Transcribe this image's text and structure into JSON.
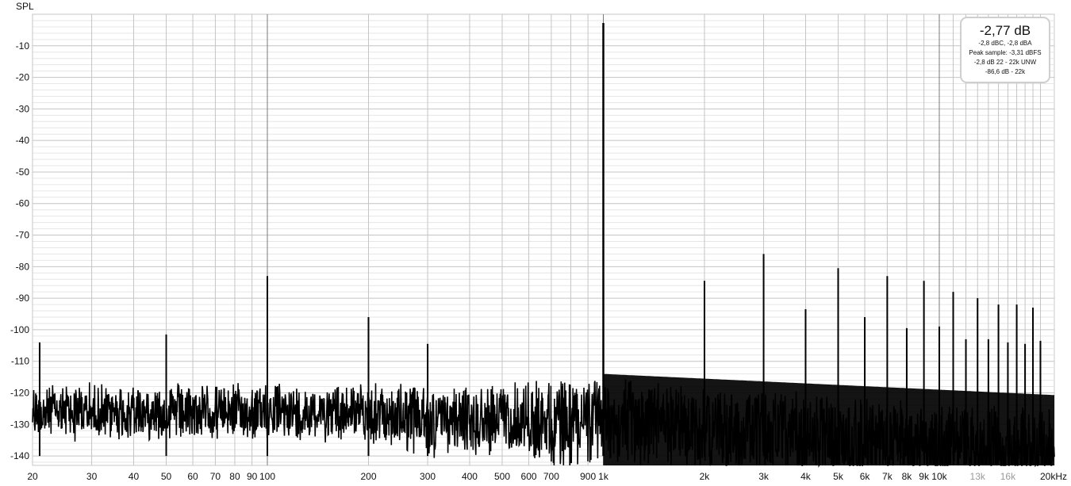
{
  "chart_data": {
    "type": "line",
    "ylabel": "SPL",
    "xscale": "log",
    "xlim": [
      20,
      22000
    ],
    "ylim": [
      -143,
      0
    ],
    "x_ticks": [
      "20",
      "30",
      "40",
      "50",
      "60",
      "70",
      "80",
      "90",
      "100",
      "200",
      "300",
      "400",
      "500",
      "600",
      "700",
      "900",
      "1k",
      "2k",
      "3k",
      "4k",
      "5k",
      "6k",
      "7k",
      "8k",
      "9k",
      "10k",
      "13k",
      "16k",
      "20kHz"
    ],
    "x_tick_values": [
      20,
      30,
      40,
      50,
      60,
      70,
      80,
      90,
      100,
      200,
      300,
      400,
      500,
      600,
      700,
      900,
      1000,
      2000,
      3000,
      4000,
      5000,
      6000,
      7000,
      8000,
      9000,
      10000,
      13000,
      16000,
      20000
    ],
    "y_ticks": [
      -10,
      -20,
      -30,
      -40,
      -50,
      -60,
      -70,
      -80,
      -90,
      -100,
      -110,
      -120,
      -130,
      -140
    ],
    "grid": true,
    "series": [
      {
        "color": "#000000",
        "noise_floor_db": -122,
        "peaks": [
          {
            "x": 21,
            "y": -104
          },
          {
            "x": 50,
            "y": -101.5
          },
          {
            "x": 100,
            "y": -83
          },
          {
            "x": 200,
            "y": -96
          },
          {
            "x": 300,
            "y": -104.5
          },
          {
            "x": 1000,
            "y": -2.77
          },
          {
            "x": 2000,
            "y": -84.5
          },
          {
            "x": 3000,
            "y": -76
          },
          {
            "x": 4000,
            "y": -93.5
          },
          {
            "x": 5000,
            "y": -80.5
          },
          {
            "x": 6000,
            "y": -96
          },
          {
            "x": 7000,
            "y": -83
          },
          {
            "x": 8000,
            "y": -99.5
          },
          {
            "x": 9000,
            "y": -84.5
          },
          {
            "x": 10000,
            "y": -99
          },
          {
            "x": 11000,
            "y": -88
          },
          {
            "x": 12000,
            "y": -103
          },
          {
            "x": 13000,
            "y": -90
          },
          {
            "x": 14000,
            "y": -103
          },
          {
            "x": 15000,
            "y": -92
          },
          {
            "x": 16000,
            "y": -104
          },
          {
            "x": 17000,
            "y": -92
          },
          {
            "x": 18000,
            "y": -104.5
          },
          {
            "x": 19000,
            "y": -93
          },
          {
            "x": 20000,
            "y": -103.5
          }
        ]
      }
    ],
    "annotations": {
      "level": "-2,77  dB",
      "line1": "-2,8 dBC, -2,8 dBA",
      "line2": "Peak sample: -3,31 dBFS",
      "line3": "-2,8 dB 22 - 22k UNW",
      "line4": "-86,6 dB - 22k"
    }
  }
}
